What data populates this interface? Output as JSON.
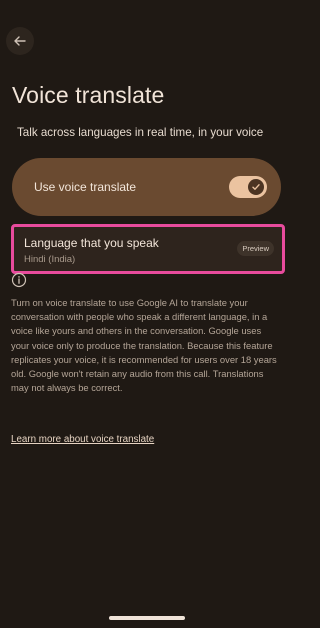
{
  "header": {
    "back_icon": "arrow-left-icon"
  },
  "page": {
    "title": "Voice translate",
    "subtitle": "Talk across languages in real time, in your voice"
  },
  "toggle": {
    "label": "Use voice translate",
    "on": true
  },
  "language": {
    "title": "Language that you speak",
    "value": "Hindi (India)",
    "badge": "Preview"
  },
  "info": {
    "icon": "info-icon",
    "text": "Turn on voice translate to use Google AI to translate your conversation with people who speak a different language, in a voice like yours and others in the conversation. Google uses your voice only to produce the translation. Because this feature replicates your voice, it is recommended for users over 18 years old. Google won't retain any audio from this call. Translations may not always be correct.",
    "link": "Learn more about voice translate"
  },
  "colors": {
    "background": "#1f1914",
    "toggle_card": "#6a4a30",
    "switch_track": "#ebc3a0",
    "highlight": "#e84b9d"
  }
}
